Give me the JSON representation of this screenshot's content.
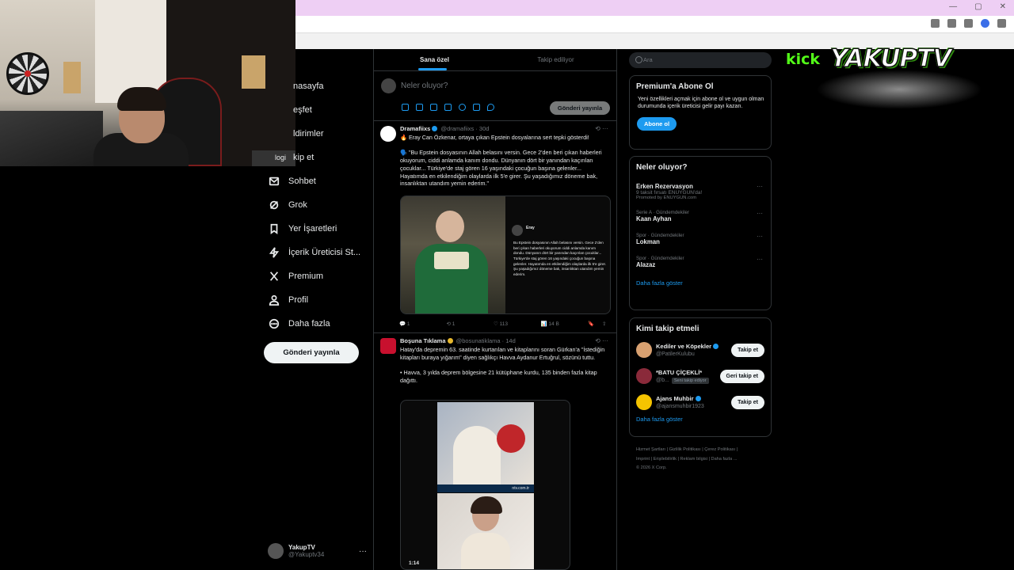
{
  "chrome": {},
  "nav": {
    "items": [
      {
        "label": "nasayfa",
        "icon": "home-icon"
      },
      {
        "label": "eşfet",
        "icon": "search-icon"
      },
      {
        "label": "ldirimler",
        "icon": "bell-icon"
      },
      {
        "label": "kip et",
        "icon": "follow-icon"
      },
      {
        "label": "Sohbet",
        "icon": "mail-icon"
      },
      {
        "label": "Grok",
        "icon": "grok-icon"
      },
      {
        "label": "Yer İşaretleri",
        "icon": "bookmark-icon"
      },
      {
        "label": "İçerik Üreticisi St...",
        "icon": "lightning-icon"
      },
      {
        "label": "Premium",
        "icon": "x-logo-icon"
      },
      {
        "label": "Profil",
        "icon": "profile-icon"
      },
      {
        "label": "Daha fazla",
        "icon": "more-circle-icon"
      }
    ],
    "logo_overlay": "logi",
    "post_button": "Gönderi yayınla"
  },
  "account": {
    "name": "YakupTV",
    "handle": "@Yakuptv34",
    "more": "···"
  },
  "feed": {
    "tabs": [
      "Sana özel",
      "Takip ediliyor"
    ],
    "composer_placeholder": "Neler oluyor?",
    "composer_button": "Gönderi yayınla",
    "tweets": [
      {
        "name": "Dramafiixs",
        "handle": "@dramafiixs · 30d",
        "body": "🔥 Eray Can Özkenar, ortaya çıkan Epstein dosyalarına sert tepki gösterdi!\n\n🗣️ \"Bu Epstein dosyasının Allah belasını versin. Gece 2'den beri çıkan haberleri okuyorum, ciddi anlamda kanım dondu. Dünyanın dört bir yanından kaçırılan çocuklar... Türkiye'de staj gören 16 yaşındaki çocuğun başına gelenler... Hayatımda en etkilendiğim olaylarda ilk 5'e girer. Şu yaşadığımız döneme bak, insanlıktan utandım yemin ederim.\"",
        "embed_name": "Eray",
        "embed_text": "Bu Epstein dosyasının Allah belasını versin. Gece 2'den beri çıkan haberleri okuyorum ciddi anlamda kanım dondu. Dünyanın dört bir yanından kaçırılan çocuklar... Türkiye'de staj gören 16 yaşındaki çocuğun başına gelenler. Hayatımda en etkilendiğim olaylarda ilk 5'e girer. Şu yaşadığımız döneme bak, insanlıktan utandım yemin ederim.",
        "replies": "1",
        "reposts": "1",
        "likes": "113",
        "views": "14 B"
      },
      {
        "name": "Boşuna Tıklama",
        "handle": "@bosunatiklama · 14d",
        "body": "Hatay'da depremin 63. saatinde kurtarılan ve kitaplarını soran Gürkan'a \"İstediğin kitapları buraya yığarım\" diyen sağlıkçı Havva Aydanur Ertuğrul, sözünü tuttu.\n\n• Havva, 3 yılda deprem bölgesine 21 kütüphane kurdu, 135 binden fazla kitap dağıttı.",
        "video_caption": "ntv.com.tr",
        "video_time": "1:14"
      }
    ]
  },
  "sidebar": {
    "search_placeholder": "Ara",
    "premium": {
      "title": "Premium'a Abone Ol",
      "desc": "Yeni özellikleri açmak için abone ol ve uygun olman durumunda içerik üreticisi gelir payı kazan.",
      "button": "Abone ol"
    },
    "trends_title": "Neler oluyor?",
    "trends": [
      {
        "ctx": "",
        "name": "Erken Rezervasyon",
        "sub": "9 taksit fırsatı ENUYGUN'da!",
        "promo": "Promoted by ENUYGUN.com"
      },
      {
        "ctx": "Serie A · Gündemdekiler",
        "name": "Kaan Ayhan"
      },
      {
        "ctx": "Spor · Gündemdekiler",
        "name": "Lokman"
      },
      {
        "ctx": "Spor · Gündemdekiler",
        "name": "Alazaz"
      }
    ],
    "trends_more": "Daha fazla göster",
    "who_title": "Kimi takip etmeli",
    "who": [
      {
        "name": "Kediler ve Köpekler",
        "handle": "@PatilerKulubu",
        "button": "Takip et",
        "badge": ""
      },
      {
        "name": "*BATU ÇİÇEKLİ*",
        "handle": "@b...",
        "button": "Geri takip et",
        "badge": "Seni takip ediyor"
      },
      {
        "name": "Ajans Muhbir",
        "handle": "@ajansmuhbir1923",
        "button": "Takip et",
        "badge": ""
      }
    ],
    "who_more": "Daha fazla göster",
    "footer": [
      "Hizmet Şartları",
      "Gizlilik Politikası",
      "Çerez Politikası",
      "Imprint",
      "Erişilebilirlik",
      "Reklam bilgisi",
      "Daha fazla ...",
      "© 2026 X Corp."
    ]
  },
  "brand": {
    "kick": "kick",
    "name": "YAKUPTV",
    "accent": "#53fc18"
  }
}
